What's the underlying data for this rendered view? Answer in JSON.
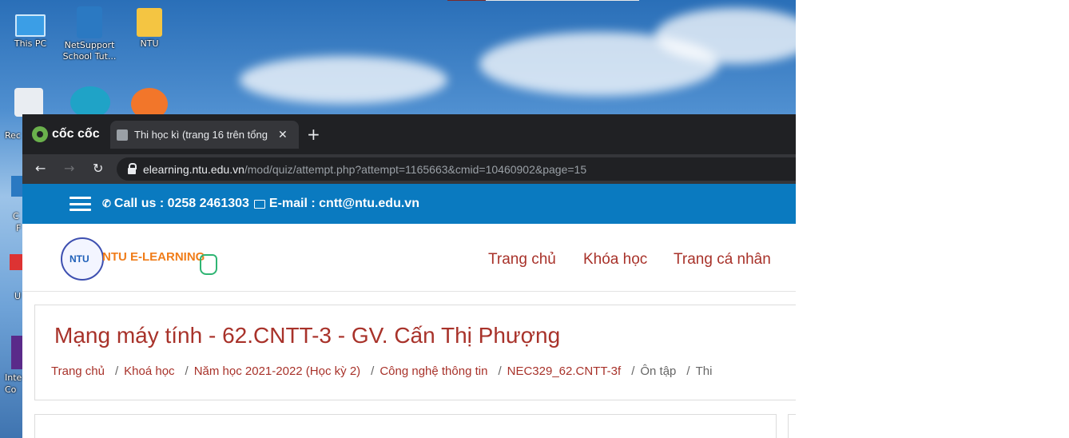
{
  "desktop": {
    "icons": [
      {
        "label": "This PC"
      },
      {
        "label": "NetSupport School Tut..."
      },
      {
        "label": "NTU"
      }
    ],
    "partial_labels": [
      "Rec",
      "C",
      "F",
      "U",
      "Inte",
      "Co"
    ]
  },
  "browser": {
    "brand": "cốc cốc",
    "tab_title": "Thi học kì (trang 16 trên tổng",
    "close": "✕",
    "new_tab": "+",
    "back": "←",
    "forward": "→",
    "reload": "↻",
    "url_host": "elearning.ntu.edu.vn",
    "url_path": "/mod/quiz/attempt.php?attempt=1165663&cmid=10460902&page=15"
  },
  "site": {
    "call_label": "Call us : 0258 2461303",
    "email_label": "E-mail : cntt@ntu.edu.vn",
    "site_name": "NTU E-LEARNING",
    "nav": [
      "Trang chủ",
      "Khóa học",
      "Trang cá nhân"
    ],
    "course_title": "Mạng máy tính - 62.CNTT-3 - GV. Cấn Thị Phượng",
    "breadcrumb": [
      "Trang chủ",
      "Khoá học",
      "Năm học 2021-2022 (Học kỳ 2)",
      "Công nghệ thông tin",
      "NEC329_62.CNTT-3f",
      "Ôn tập",
      "Thi"
    ]
  }
}
